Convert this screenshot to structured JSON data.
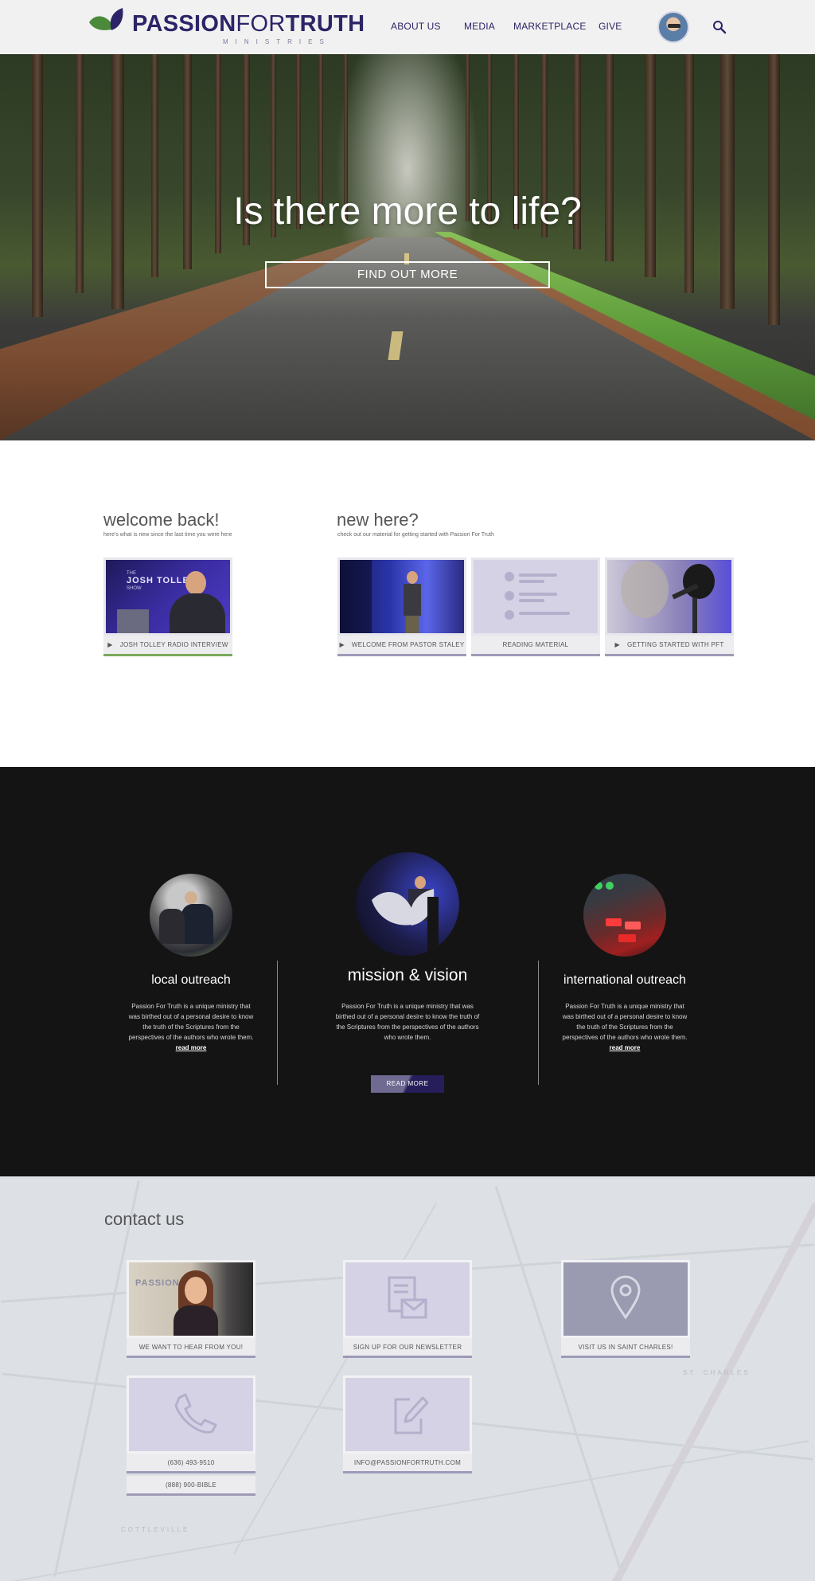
{
  "header": {
    "logo_main_bold": "PASSION",
    "logo_main_thin": "FOR",
    "logo_main_end": "TRUTH",
    "logo_sub": "MINISTRIES",
    "nav": [
      "ABOUT US",
      "MEDIA",
      "MARKETPLACE",
      "GIVE"
    ]
  },
  "hero": {
    "title": "Is there more to life?",
    "button": "FIND OUT MORE"
  },
  "welcome": {
    "title": "welcome back!",
    "subtitle": "here's what is new since the last time you were here",
    "cards": [
      {
        "label": "JOSH TOLLEY RADIO INTERVIEW",
        "thumb_text_1": "THE",
        "thumb_text_2": "JOSH TOLLEY",
        "thumb_text_3": "SHOW"
      }
    ]
  },
  "new_here": {
    "title": "new here?",
    "subtitle": "check out our material for getting started with Passion For Truth",
    "cards": [
      {
        "label": "WELCOME FROM PASTOR STALEY"
      },
      {
        "label": "READING MATERIAL"
      },
      {
        "label": "GETTING STARTED WITH PFT"
      }
    ]
  },
  "ministry": {
    "columns": [
      {
        "title": "local outreach",
        "text": "Passion For Truth is a unique ministry that was birthed out of a personal desire to know the truth of the Scriptures from the perspectives of the authors who wrote them.",
        "link": "read more"
      },
      {
        "title": "mission & vision",
        "text": "Passion For Truth is a unique ministry that was birthed out of a personal desire to know the truth of the Scriptures from the perspectives of the authors who wrote them.",
        "button": "READ MORE"
      },
      {
        "title": "international outreach",
        "text": "Passion For Truth is a unique ministry that was birthed out of a personal desire to know the truth of the Scriptures from the perspectives of the authors who wrote them.",
        "link": "read more"
      }
    ]
  },
  "contact": {
    "title": "contact us",
    "cards": [
      {
        "label": "WE WANT TO HEAR FROM YOU!",
        "thumb_text": "PASSION"
      },
      {
        "label": "SIGN UP FOR OUR NEWSLETTER"
      },
      {
        "label": "VISIT US IN SAINT CHARLES!"
      },
      {
        "label": "(636) 493-9510",
        "label_2": "(888) 900-BIBLE"
      },
      {
        "label": "INFO@PASSIONFORTRUTH.COM"
      }
    ],
    "map_labels": [
      "ST. CHARLES",
      "COTTLEVILLE"
    ]
  },
  "colors": {
    "brand_navy": "#2b2467",
    "brand_green": "#4a8a3a",
    "card_lavender": "#d5d2e6",
    "card_border": "#9e9ab8",
    "dark_bg": "#141414"
  },
  "icons": [
    "leaf-logo-icon",
    "search-icon",
    "play-icon",
    "document-list-icon",
    "microphone-icon",
    "newsletter-icon",
    "location-pin-icon",
    "phone-icon",
    "edit-icon"
  ]
}
